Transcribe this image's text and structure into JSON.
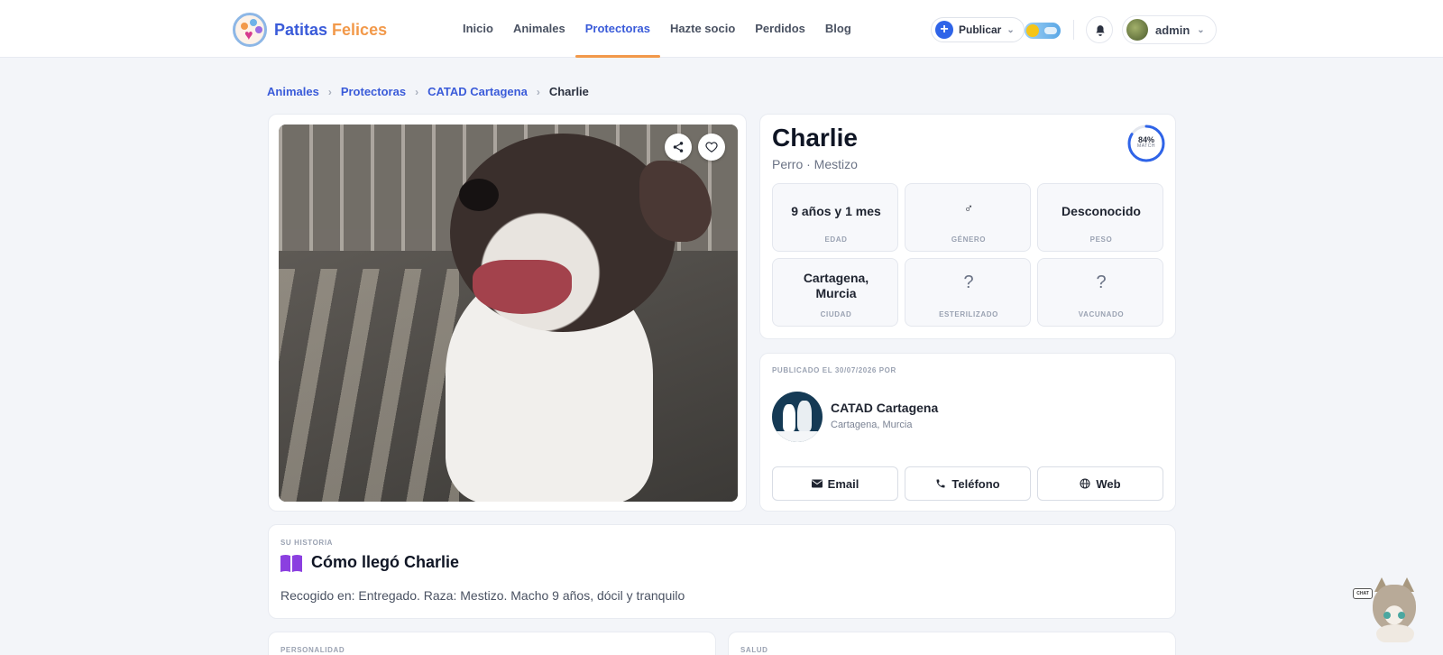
{
  "brand": {
    "name_part1": "Patitas",
    "name_part2": "Felices",
    "logo_icon": "paw-heart-logo"
  },
  "nav": {
    "links": [
      {
        "label": "Inicio",
        "active": false
      },
      {
        "label": "Animales",
        "active": false
      },
      {
        "label": "Protectoras",
        "active": true
      },
      {
        "label": "Hazte socio",
        "active": false
      },
      {
        "label": "Perdidos",
        "active": false
      },
      {
        "label": "Blog",
        "active": false
      }
    ],
    "publish_label": "Publicar",
    "user_name": "admin"
  },
  "breadcrumb": [
    "Animales",
    "Protectoras",
    "CATAD Cartagena",
    "Charlie"
  ],
  "pet": {
    "name": "Charlie",
    "subtitle": "Perro · Mestizo",
    "match_percent": "84%",
    "match_label": "MATCH",
    "match_value": 0.84,
    "stats": [
      {
        "value": "9 años y 1 mes",
        "key": "EDAD"
      },
      {
        "value": "♂",
        "key": "GÉNERO"
      },
      {
        "value": "Desconocido",
        "key": "PESO"
      },
      {
        "value": "Cartagena, Murcia",
        "key": "CIUDAD"
      },
      {
        "value": "?",
        "key": "ESTERILIZADO"
      },
      {
        "value": "?",
        "key": "VACUNADO"
      }
    ]
  },
  "publisher": {
    "label": "PUBLICADO EL 30/07/2026 POR",
    "name": "CATAD Cartagena",
    "city": "Cartagena, Murcia",
    "contacts": [
      {
        "label": "Email",
        "icon": "envelope-icon"
      },
      {
        "label": "Teléfono",
        "icon": "phone-icon"
      },
      {
        "label": "Web",
        "icon": "globe-icon"
      }
    ]
  },
  "story": {
    "label": "SU HISTORIA",
    "title": "Cómo llegó Charlie",
    "text": "Recogido en: Entregado. Raza: Mestizo. Macho 9 años, dócil y tranquilo"
  },
  "sections": {
    "personality_label": "PERSONALIDAD",
    "health_label": "SALUD"
  },
  "chat": {
    "bubble": "CHAT"
  },
  "colors": {
    "primary": "#3a5bd9",
    "accent": "#f2994a",
    "match_ring": "#2f64e8",
    "story_icon": "#8b3fe0"
  }
}
